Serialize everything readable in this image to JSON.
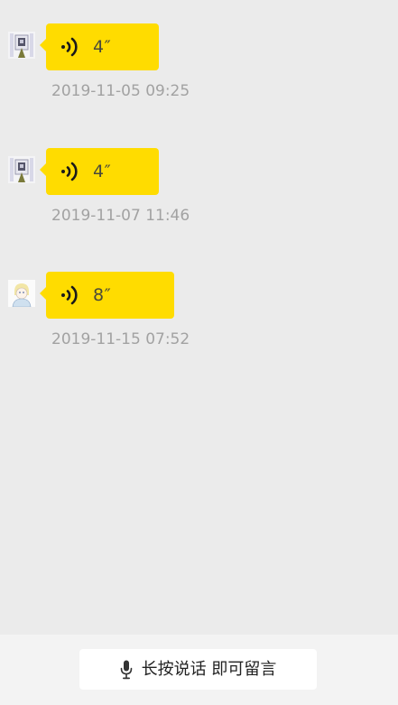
{
  "messages": [
    {
      "avatar": "user-avatar-1",
      "duration": "4″",
      "timestamp": "2019-11-05 09:25"
    },
    {
      "avatar": "user-avatar-1",
      "duration": "4″",
      "timestamp": "2019-11-07 11:46"
    },
    {
      "avatar": "user-avatar-2",
      "duration": "8″",
      "timestamp": "2019-11-15 07:52"
    }
  ],
  "footer": {
    "record_label": "长按说话 即可留言",
    "icon": "microphone-icon"
  },
  "colors": {
    "background": "#ebebeb",
    "bubble": "#ffdc00",
    "timestamp": "#a2a2a2",
    "footer": "#f3f3f3"
  }
}
